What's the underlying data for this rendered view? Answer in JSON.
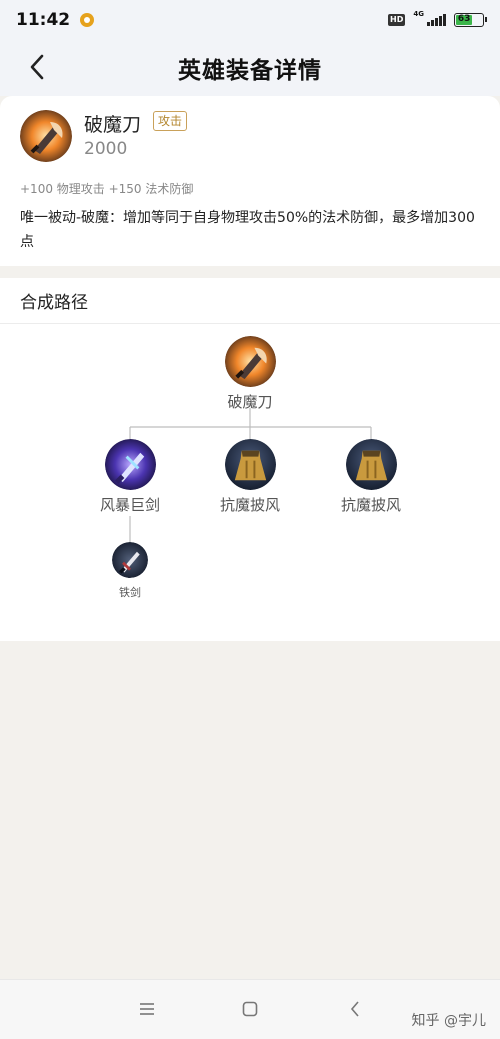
{
  "status_bar": {
    "time": "11:42",
    "hd_label": "HD",
    "network": "4G",
    "battery": "63"
  },
  "header": {
    "title": "英雄装备详情"
  },
  "item": {
    "name": "破魔刀",
    "tag": "攻击",
    "price": "2000",
    "stats": "+100 物理攻击 +150 法术防御",
    "passive": "唯一被动-破魔：增加等同于自身物理攻击50%的法术防御，最多增加300点"
  },
  "recipe": {
    "title": "合成路径",
    "root": {
      "label": "破魔刀",
      "icon": "demon-blade-icon"
    },
    "components": [
      {
        "label": "风暴巨剑",
        "icon": "storm-sword-icon"
      },
      {
        "label": "抗魔披风",
        "icon": "magic-cloak-icon"
      },
      {
        "label": "抗魔披风",
        "icon": "magic-cloak-icon"
      }
    ],
    "sub_component": {
      "label": "铁剑",
      "icon": "iron-sword-icon"
    }
  },
  "nav_bar": {
    "watermark": "知乎 @宇儿"
  },
  "colors": {
    "tag": "#b3862e",
    "battery": "#3bb54a",
    "background": "#f3f1ed"
  }
}
